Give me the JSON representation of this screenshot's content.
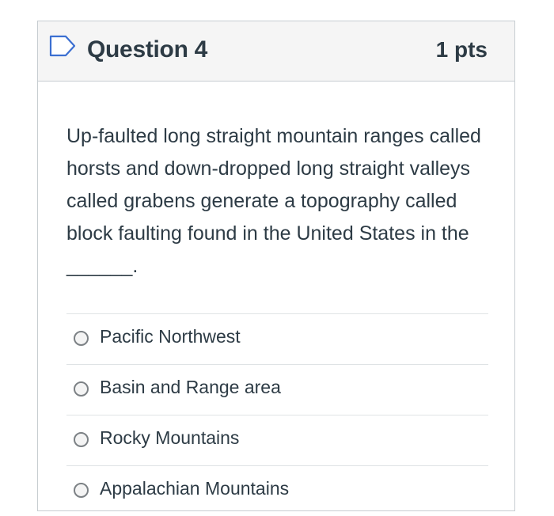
{
  "question": {
    "title": "Question 4",
    "points": "1 pts",
    "text": "Up-faulted long straight mountain ranges called horsts and down-dropped long straight valleys called grabens generate a topography called block faulting found in the United States in the ______.",
    "flag_icon": "flag-outline-icon"
  },
  "answers": [
    {
      "label": "Pacific Northwest",
      "selected": false
    },
    {
      "label": "Basin and Range area",
      "selected": false
    },
    {
      "label": "Rocky Mountains",
      "selected": false
    },
    {
      "label": "Appalachian Mountains",
      "selected": false
    }
  ],
  "colors": {
    "text": "#2d3b45",
    "header_bg": "#f5f5f5",
    "border": "#c7cdd1",
    "flag_stroke": "#3b6fd1"
  }
}
